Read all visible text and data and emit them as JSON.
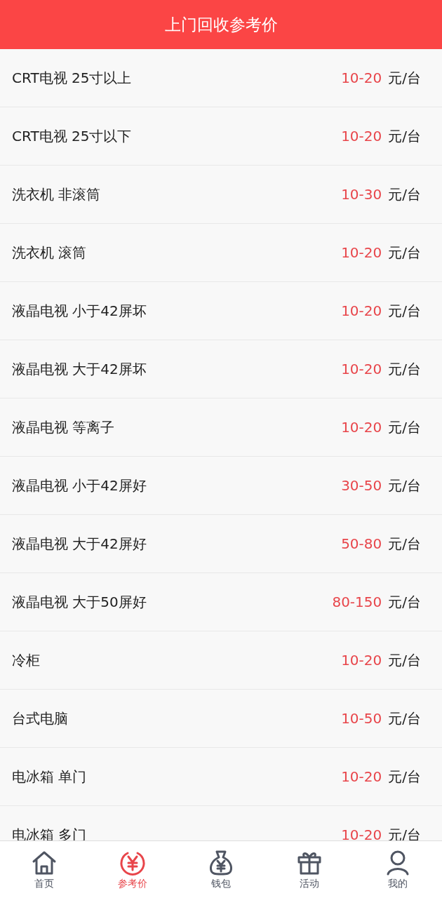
{
  "header": {
    "title": "上门回收参考价"
  },
  "items": [
    {
      "name": "CRT电视 25寸以上",
      "price": "10-20",
      "unit": "元/台"
    },
    {
      "name": "CRT电视 25寸以下",
      "price": "10-20",
      "unit": "元/台"
    },
    {
      "name": "洗衣机 非滚筒",
      "price": "10-30",
      "unit": "元/台"
    },
    {
      "name": "洗衣机 滚筒",
      "price": "10-20",
      "unit": "元/台"
    },
    {
      "name": "液晶电视 小于42屏坏",
      "price": "10-20",
      "unit": "元/台"
    },
    {
      "name": "液晶电视 大于42屏坏",
      "price": "10-20",
      "unit": "元/台"
    },
    {
      "name": "液晶电视 等离子",
      "price": "10-20",
      "unit": "元/台"
    },
    {
      "name": "液晶电视 小于42屏好",
      "price": "30-50",
      "unit": "元/台"
    },
    {
      "name": "液晶电视 大于42屏好",
      "price": "50-80",
      "unit": "元/台"
    },
    {
      "name": "液晶电视 大于50屏好",
      "price": "80-150",
      "unit": "元/台"
    },
    {
      "name": "冷柜",
      "price": "10-20",
      "unit": "元/台"
    },
    {
      "name": "台式电脑",
      "price": "10-50",
      "unit": "元/台"
    },
    {
      "name": "电冰箱 单门",
      "price": "10-20",
      "unit": "元/台"
    },
    {
      "name": "电冰箱 多门",
      "price": "10-20",
      "unit": "元/台"
    }
  ],
  "tabs": [
    {
      "kind": "home",
      "label": "首页",
      "selected": false
    },
    {
      "kind": "price",
      "label": "参考价",
      "selected": true
    },
    {
      "kind": "wallet",
      "label": "钱包",
      "selected": false
    },
    {
      "kind": "gift",
      "label": "活动",
      "selected": false
    },
    {
      "kind": "profile",
      "label": "我的",
      "selected": false
    }
  ]
}
